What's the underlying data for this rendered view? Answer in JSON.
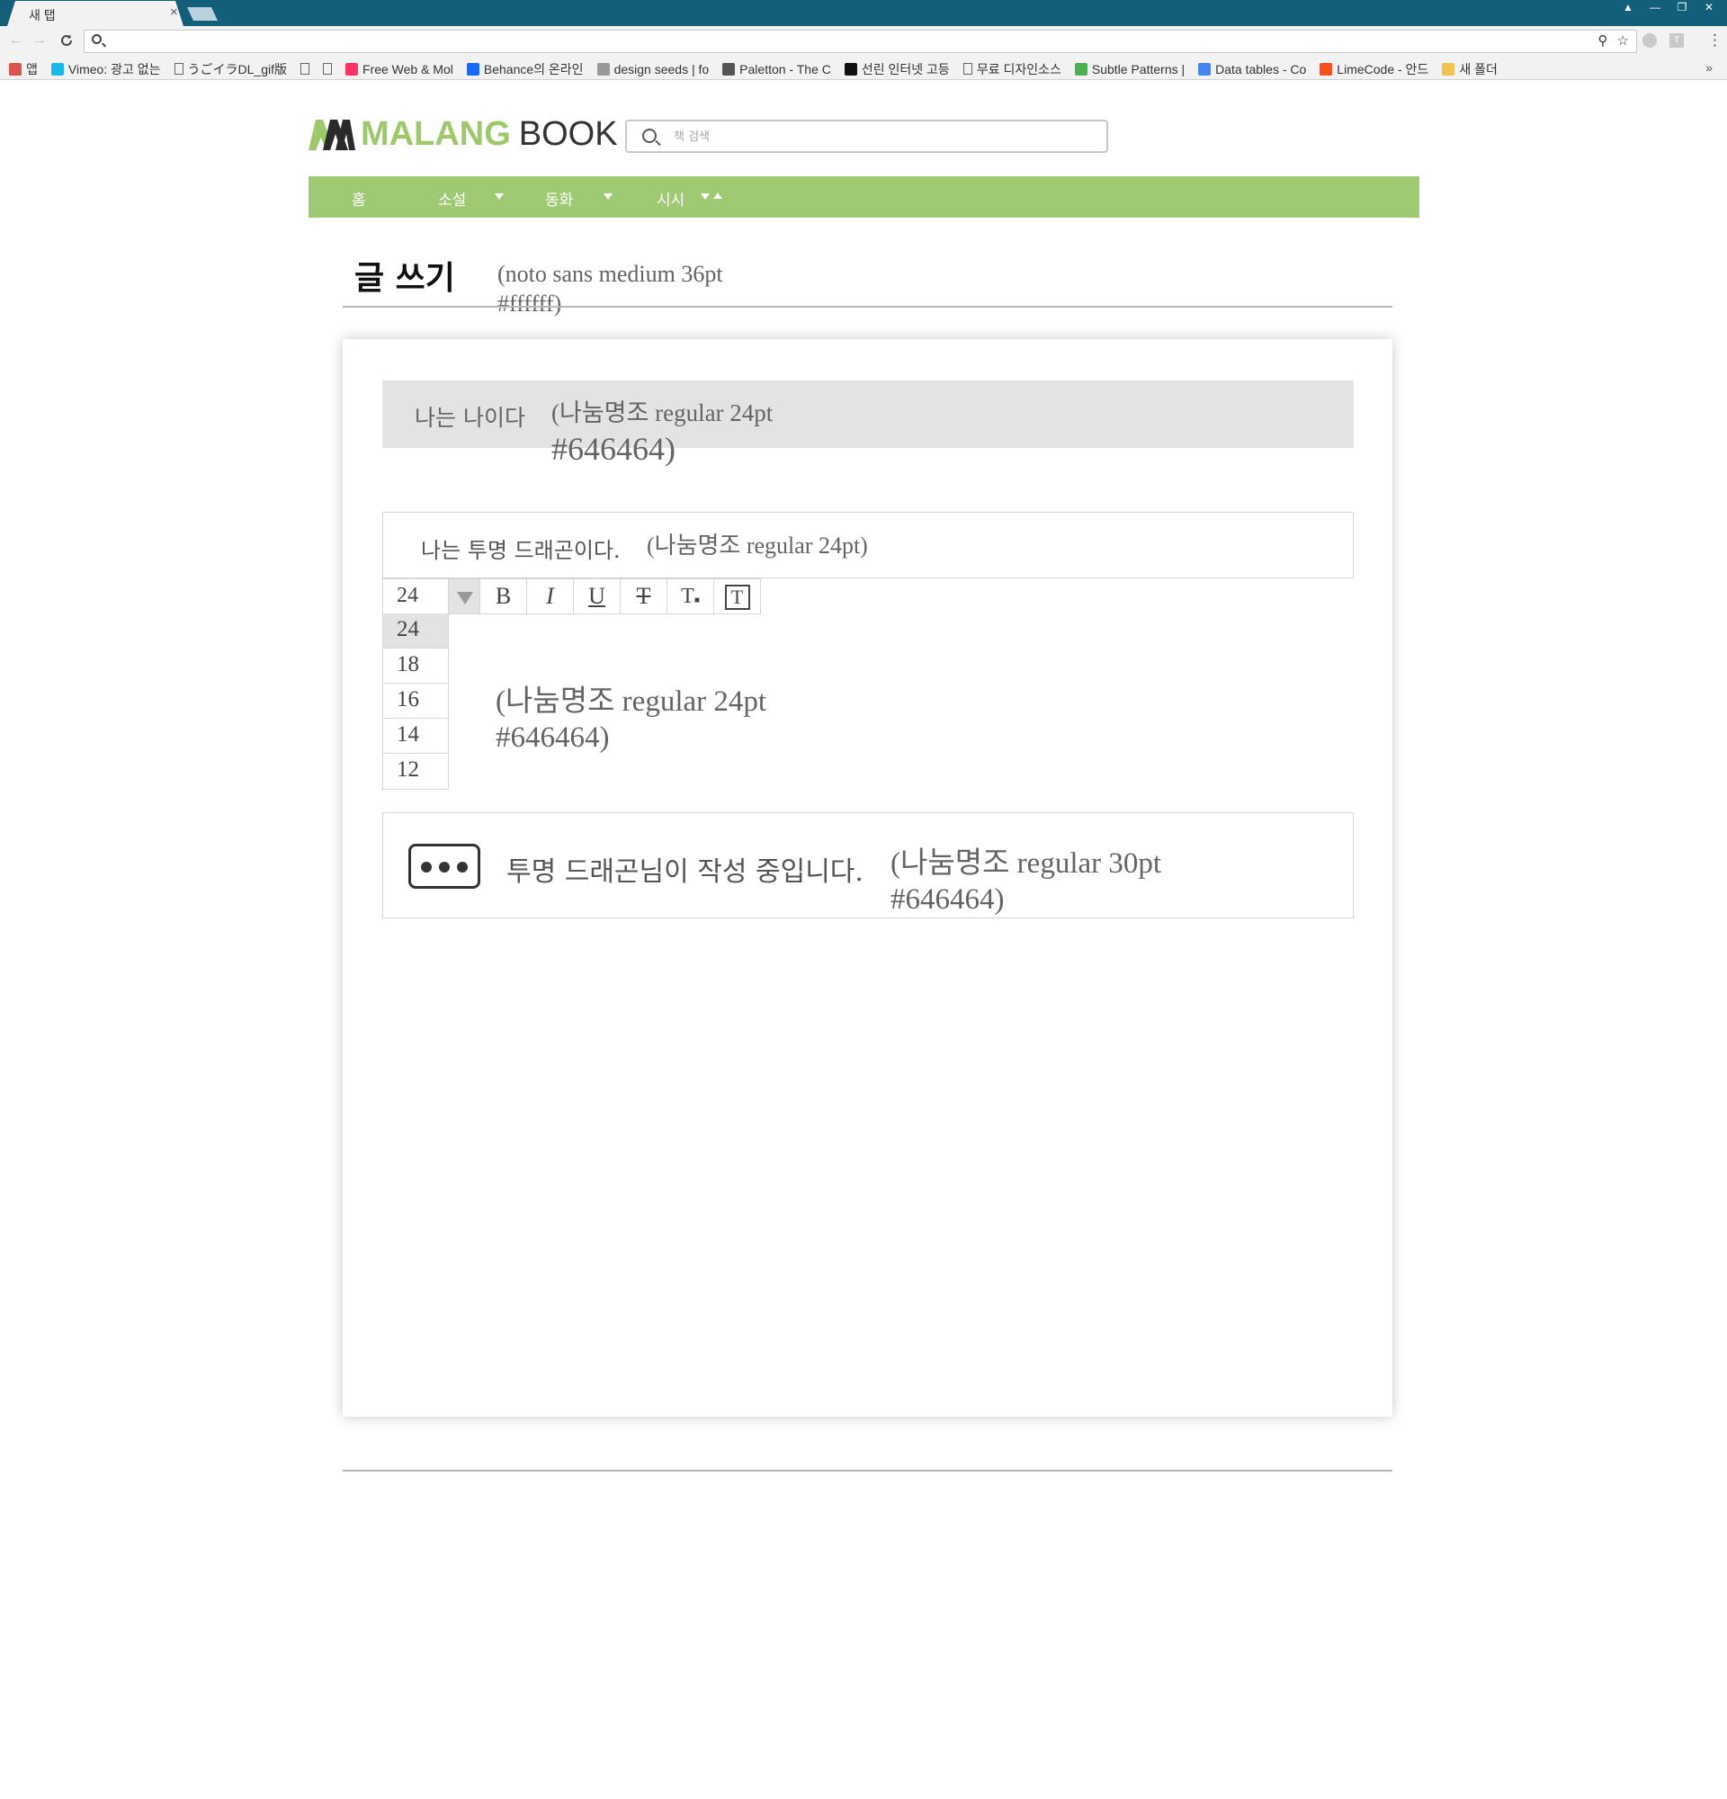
{
  "browser": {
    "tab_title": "새 탭",
    "tab_close": "×",
    "win_controls": [
      "▲",
      "—",
      "❐",
      "✕"
    ],
    "nav": {
      "back": "←",
      "forward": "→",
      "reload": "C"
    },
    "omnibox_icons": [
      "⚲",
      "☆"
    ],
    "ext_letter": "T",
    "menu": "⋮",
    "bookmarks": [
      {
        "label": "앱",
        "icon": "apps-grid-icon",
        "color": "#d9534f"
      },
      {
        "label": "Vimeo: 광고 없는",
        "icon": "vimeo-icon",
        "color": "#1ab7ea"
      },
      {
        "label": "うごイラDL_gif版",
        "icon": "page-icon",
        "color": ""
      },
      {
        "label": "",
        "icon": "page-icon",
        "color": ""
      },
      {
        "label": "",
        "icon": "page-icon",
        "color": ""
      },
      {
        "label": "Free Web & Mol",
        "icon": "invision-icon",
        "color": "#ff3366"
      },
      {
        "label": "Behance의 온라인",
        "icon": "behance-icon",
        "color": "#1769ff"
      },
      {
        "label": "design seeds | fo",
        "icon": "designseeds-icon",
        "color": "#999999"
      },
      {
        "label": "Paletton - The C",
        "icon": "paletton-icon",
        "color": "#555555"
      },
      {
        "label": "선린 인터넷 고등",
        "icon": "sunrin-icon",
        "color": "#111111"
      },
      {
        "label": "무료 디자인소스",
        "icon": "page-icon",
        "color": ""
      },
      {
        "label": "Subtle Patterns |",
        "icon": "subtle-patterns-icon",
        "color": "#4caf50"
      },
      {
        "label": "Data tables - Co",
        "icon": "google-icon",
        "color": "#4285f4"
      },
      {
        "label": "LimeCode - 안드",
        "icon": "limecode-icon",
        "color": "#f4511e"
      },
      {
        "label": "새 폴더",
        "icon": "folder-icon",
        "color": "#f0c350"
      }
    ],
    "bookmarks_more": "»"
  },
  "logo": {
    "brand": "MALANG",
    "suffix": "BOOK",
    "accent": "#9ec96a"
  },
  "search": {
    "placeholder": "책 검색"
  },
  "nav": [
    {
      "label": "홈"
    },
    {
      "label": "소설"
    },
    {
      "label": "동화"
    },
    {
      "label": "시시"
    }
  ],
  "nav_color": "#a0c973",
  "page": {
    "title": "글 쓰기",
    "title_annotation_1": "(noto sans medium 36pt",
    "title_annotation_2": "#ffffff)"
  },
  "post": {
    "title_value": "나는 나이다",
    "title_annotation_1": "(나눔명조 regular 24pt",
    "title_annotation_2": "#646464)",
    "content_value": "나는 투명 드래곤이다.",
    "content_annotation": "(나눔명조 regular 24pt)"
  },
  "editor": {
    "font_size": "24",
    "buttons": [
      "B",
      "I",
      "U",
      "T",
      "T",
      "T"
    ],
    "size_options": [
      "24",
      "18",
      "16",
      "14",
      "12"
    ],
    "selected_size": "24",
    "annotation_1": "(나눔명조 regular 24pt",
    "annotation_2": "#646464)"
  },
  "typing": {
    "text": "투명 드래곤님이 작성 중입니다.",
    "annotation_1": "(나눔명조 regular 30pt",
    "annotation_2": "#646464)"
  }
}
